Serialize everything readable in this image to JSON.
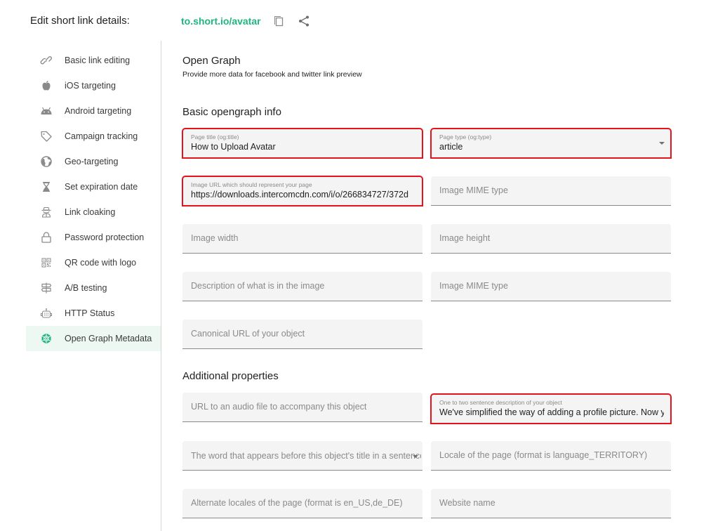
{
  "header": {
    "title": "Edit short link details:",
    "short_link": "to.short.io/avatar",
    "icons": [
      "copy-icon",
      "share-icon"
    ]
  },
  "sidebar": {
    "items": [
      {
        "label": "Basic link editing",
        "icon": "link-icon",
        "active": false
      },
      {
        "label": "iOS targeting",
        "icon": "apple-icon",
        "active": false
      },
      {
        "label": "Android targeting",
        "icon": "android-icon",
        "active": false
      },
      {
        "label": "Campaign tracking",
        "icon": "tag-icon",
        "active": false
      },
      {
        "label": "Geo-targeting",
        "icon": "globe-icon",
        "active": false
      },
      {
        "label": "Set expiration date",
        "icon": "hourglass-icon",
        "active": false
      },
      {
        "label": "Link cloaking",
        "icon": "spy-icon",
        "active": false
      },
      {
        "label": "Password protection",
        "icon": "lock-icon",
        "active": false
      },
      {
        "label": "QR code with logo",
        "icon": "qr-code-icon",
        "active": false
      },
      {
        "label": "A/B testing",
        "icon": "signpost-icon",
        "active": false
      },
      {
        "label": "HTTP Status",
        "icon": "robot-icon",
        "active": false
      },
      {
        "label": "Open Graph Metadata",
        "icon": "open-graph-icon",
        "active": true
      }
    ],
    "active_color": "#1fb67e"
  },
  "main": {
    "title": "Open Graph",
    "subtitle": "Provide more data for facebook and twitter link preview",
    "basic_section": {
      "title": "Basic opengraph info",
      "fields": {
        "page_title": {
          "label": "Page title (og:title)",
          "value": "How to Upload Avatar"
        },
        "page_type": {
          "label": "Page type (og:type)",
          "value": "article"
        },
        "image_url": {
          "label": "Image URL which should represent your page",
          "value": "https://downloads.intercomcdn.com/i/o/266834727/372d"
        },
        "image_mime_1": {
          "placeholder": "Image MIME type"
        },
        "image_width": {
          "placeholder": "Image width"
        },
        "image_height": {
          "placeholder": "Image height"
        },
        "image_description": {
          "placeholder": "Description of what is in the image"
        },
        "image_mime_2": {
          "placeholder": "Image MIME type"
        },
        "canonical_url": {
          "placeholder": "Canonical URL of your object"
        }
      }
    },
    "additional_section": {
      "title": "Additional properties",
      "fields": {
        "audio_url": {
          "placeholder": "URL to an audio file to accompany this object"
        },
        "description": {
          "label": "One to two sentence description of your object",
          "value": "We've simplified the way of adding a profile picture. Now you"
        },
        "determiner": {
          "placeholder": "The word that appears before this object's title in a sentence"
        },
        "locale": {
          "placeholder": "Locale of the page (format is language_TERRITORY)"
        },
        "alternate_locales": {
          "placeholder": "Alternate locales of the page (format is en_US,de_DE)"
        },
        "site_name": {
          "placeholder": "Website name"
        }
      }
    },
    "highlight_color": "#e3141b"
  }
}
